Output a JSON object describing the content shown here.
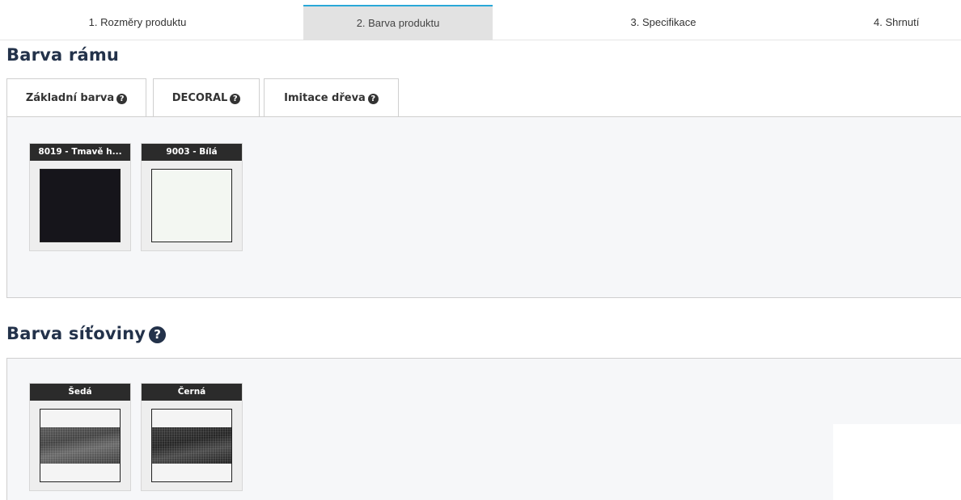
{
  "steps": [
    {
      "label": "1. Rozměry produktu"
    },
    {
      "label": "2. Barva produktu"
    },
    {
      "label": "3. Specifikace"
    },
    {
      "label": "4. Shrnutí"
    }
  ],
  "active_step": 2,
  "frame": {
    "title": "Barva rámu",
    "tabs": [
      {
        "label": "Základní barva"
      },
      {
        "label": "DECORAL"
      },
      {
        "label": "Imitace dřeva"
      }
    ],
    "swatches": [
      {
        "label": "8019 - Tmavě h...",
        "color": "#16151b"
      },
      {
        "label": "9003 - Bílá",
        "color": "#f3f7f2"
      }
    ]
  },
  "mesh": {
    "title": "Barva síťoviny",
    "swatches": [
      {
        "label": "Šedá"
      },
      {
        "label": "Černá"
      }
    ]
  },
  "icons": {
    "help": "question-circle-icon"
  },
  "colors": {
    "accent": "#2aa8d8",
    "heading": "#23324a",
    "swatch_label_bg": "#2b2b2b"
  }
}
